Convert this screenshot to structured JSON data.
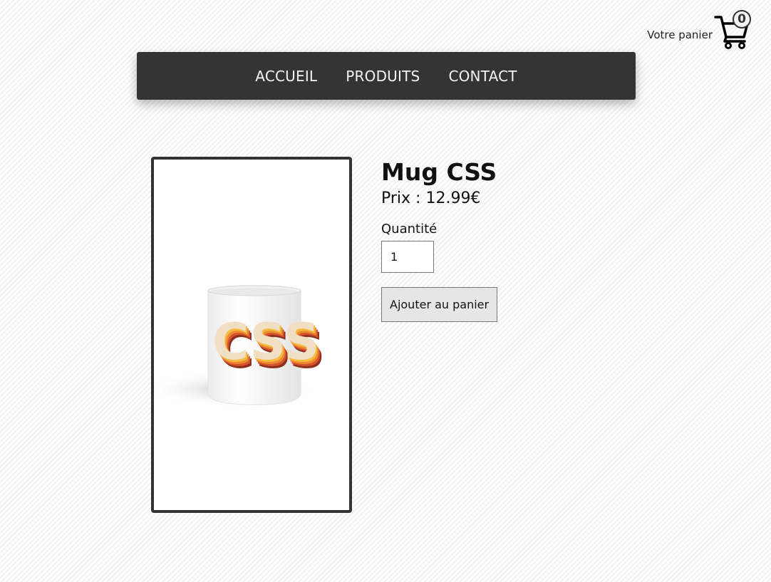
{
  "cart": {
    "label": "Votre panier",
    "count": "0",
    "icon": "shopping-cart-icon"
  },
  "nav": {
    "items": [
      {
        "label": "ACCUEIL"
      },
      {
        "label": "PRODUITS"
      },
      {
        "label": "CONTACT"
      }
    ],
    "background": "#343434"
  },
  "product": {
    "title": "Mug CSS",
    "price": "Prix : 12.99€",
    "quantity_label": "Quantité",
    "quantity_value": "1",
    "add_button_label": "Ajouter au panier",
    "image": "css-mug-image",
    "image_logo_text": "CSS"
  }
}
